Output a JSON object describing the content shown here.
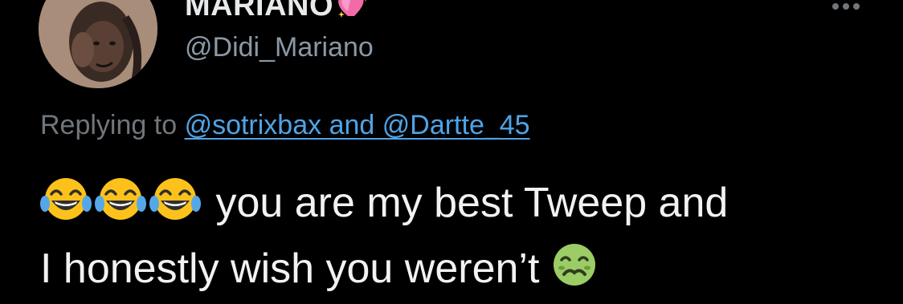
{
  "author": {
    "display_name": "MARIANO",
    "name_emoji": "sparkling-heart-icon",
    "handle": "@Didi_Mariano",
    "avatar": "profile-photo"
  },
  "header": {
    "more_icon": "more-options-icon"
  },
  "reply": {
    "prefix": "Replying to",
    "mentions": "@sotrixbax and @Dartte_45"
  },
  "tweet": {
    "emoji_1": "face-with-tears-of-joy-icon",
    "emoji_2": "face-with-tears-of-joy-icon",
    "emoji_3": "face-with-tears-of-joy-icon",
    "line_1": "you are my best Tweep and",
    "line_2": "I honestly wish you weren’t",
    "end_emoji": "nauseated-face-icon"
  },
  "colors": {
    "background": "#000000",
    "text_primary": "#e7e9ea",
    "text_secondary": "#71767b",
    "link": "#4ea4e8"
  }
}
